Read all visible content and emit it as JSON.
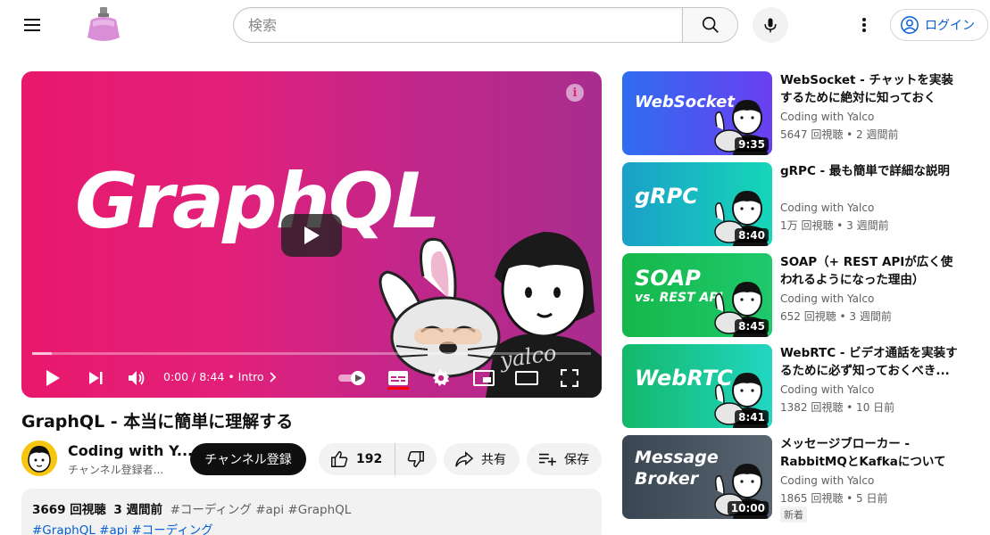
{
  "header": {
    "menu_icon": "hamburger-menu-icon",
    "logo_icon": "perfume-bottle-logo",
    "search_placeholder": "検索",
    "search_icon": "search-icon",
    "mic_icon": "microphone-icon",
    "more_icon": "more-vertical-icon",
    "login_label": "ログイン"
  },
  "player": {
    "thumbnail_title": "GraphQL",
    "info_glyph": "i",
    "time": "0:00 / 8:44",
    "chapter": "• Intro",
    "watermark": "yalco",
    "progress": 0,
    "colors": {
      "bg_start": "#e8186c",
      "bg_end": "#a82d8e"
    }
  },
  "video": {
    "title": "GraphQL - 本当に簡単に理解する",
    "channel": "Coding with Y...",
    "subscribers": "チャンネル登録者...",
    "subscribe_label": "チャンネル登録",
    "likes": "192",
    "share_label": "共有",
    "save_label": "保存",
    "desc_views": "3669 回視聴",
    "desc_date": "3 週間前",
    "desc_tags": "#コーディング #api #GraphQL",
    "desc_hashtags": "#GraphQL #api #コーディング"
  },
  "recommendations": [
    {
      "thumb_label": "WebSocket",
      "duration": "9:35",
      "title": "WebSocket - チャットを実装するために絶対に知っておくべ...",
      "channel": "Coding with Yalco",
      "meta": "5647 回視聴 • 2 週間前",
      "colors": [
        "#2f6df0",
        "#6a3ff0"
      ]
    },
    {
      "thumb_label": "gRPC",
      "duration": "8:40",
      "title": "gRPC - 最も簡単で詳細な説明",
      "channel": "Coding with Yalco",
      "meta": "1万 回視聴 • 3 週間前",
      "colors": [
        "#1aa0c8",
        "#16d6b8"
      ]
    },
    {
      "thumb_label": "SOAP",
      "thumb_sub": "vs. REST API",
      "duration": "8:45",
      "title": "SOAP（+ REST APIが広く使われるようになった理由）",
      "channel": "Coding with Yalco",
      "meta": "652 回視聴 • 3 週間前",
      "colors": [
        "#14b84a",
        "#1fc96c"
      ]
    },
    {
      "thumb_label": "WebRTC",
      "duration": "8:41",
      "title": "WebRTC - ビデオ通話を実装するために必ず知っておくべき...",
      "channel": "Coding with Yalco",
      "meta": "1382 回視聴 • 10 日前",
      "colors": [
        "#13b86a",
        "#22d6c2"
      ]
    },
    {
      "thumb_label": "Message",
      "thumb_sub": "Broker",
      "duration": "10:00",
      "title": "メッセージブローカー - RabbitMQとKafkaについて見...",
      "channel": "Coding with Yalco",
      "meta": "1865 回視聴 • 5 日前",
      "badge": "新着",
      "colors": [
        "#3a4552",
        "#5a6572"
      ]
    }
  ]
}
